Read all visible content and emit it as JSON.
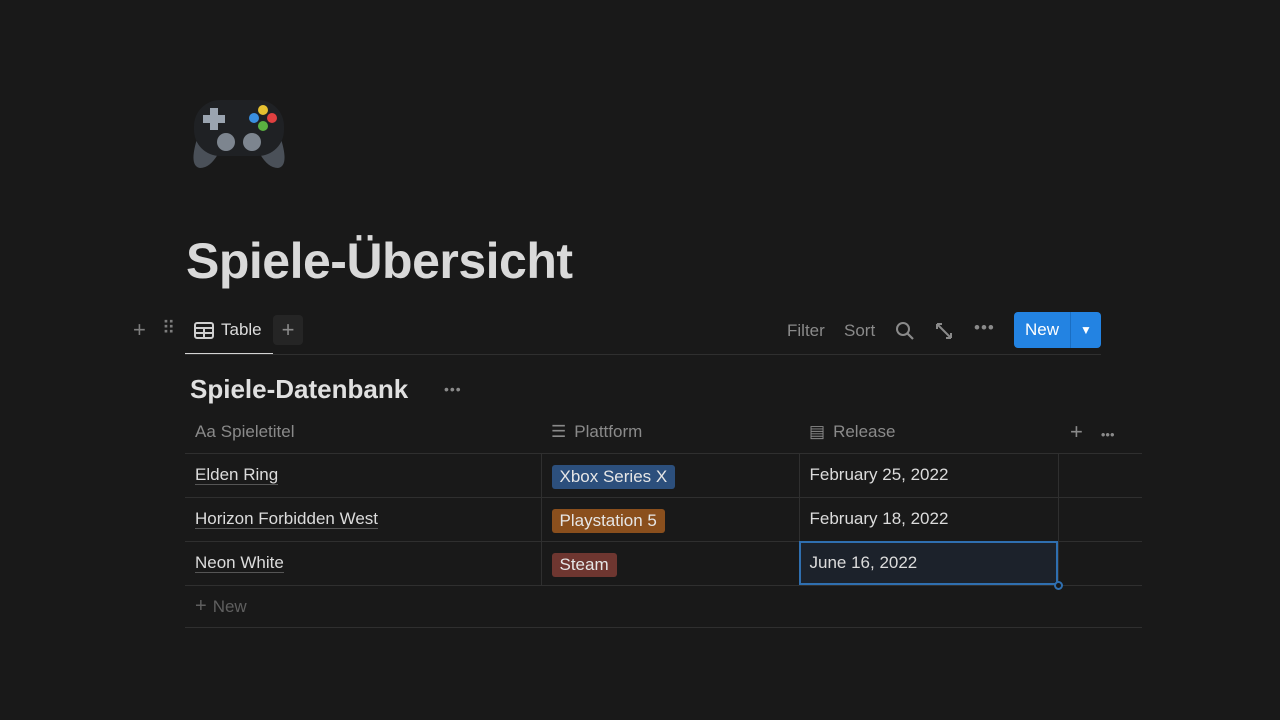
{
  "page": {
    "title": "Spiele-Übersicht",
    "icon": "game-controller-icon"
  },
  "view": {
    "tab_label": "Table",
    "filter": "Filter",
    "sort": "Sort",
    "new_label": "New"
  },
  "database": {
    "title": "Spiele-Datenbank",
    "columns": [
      {
        "label": "Spieletitel",
        "icon": "Aa"
      },
      {
        "label": "Plattform",
        "icon": "list-icon"
      },
      {
        "label": "Release",
        "icon": "calendar-icon"
      }
    ],
    "rows": [
      {
        "title": "Elden Ring",
        "platform": "Xbox Series X",
        "platform_color": "#2c4f7c",
        "release": "February 25, 2022"
      },
      {
        "title": "Horizon Forbidden West",
        "platform": "Playstation 5",
        "platform_color": "#8a4f1d",
        "release": "February 18, 2022"
      },
      {
        "title": "Neon White",
        "platform": "Steam",
        "platform_color": "#6e3630",
        "release": "June 16, 2022"
      }
    ],
    "new_row_label": "New"
  }
}
